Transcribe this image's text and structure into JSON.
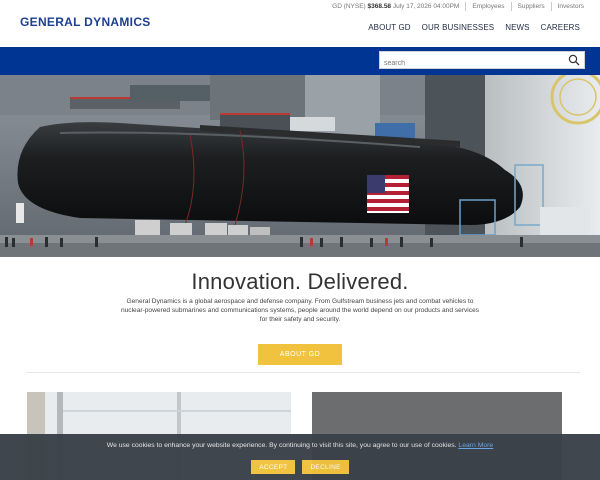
{
  "header": {
    "logo": "GENERAL DYNAMICS",
    "stock": {
      "ticker": "GD (NYSE)",
      "price": "$368.58",
      "datetime": "July 17, 2026 04:00PM"
    },
    "utility_links": [
      "Employees",
      "Suppliers",
      "Investors"
    ],
    "nav": [
      "ABOUT GD",
      "OUR BUSINESSES",
      "NEWS",
      "CAREERS"
    ]
  },
  "search": {
    "placeholder": "search",
    "icon": "search-icon"
  },
  "hero": {
    "image": "submarine-in-shipyard",
    "flag": "us-flag"
  },
  "intro": {
    "headline": "Innovation. Delivered.",
    "description": "General Dynamics is a global aerospace and defense company. From Gulfstream business jets and combat vehicles to nuclear-powered submarines and communications systems, people around the world depend on our products and services for their safety and security.",
    "button": "ABOUT GD"
  },
  "cookie": {
    "message": "We use cookies to enhance your website experience. By continuing to visit this site, you agree to our use of cookies.",
    "link": "Learn More",
    "accept": "ACCEPT",
    "decline": "DECLINE"
  },
  "colors": {
    "brand_blue": "#003594",
    "accent_gold": "#f1c23d",
    "cookie_bg": "#3a4148"
  }
}
